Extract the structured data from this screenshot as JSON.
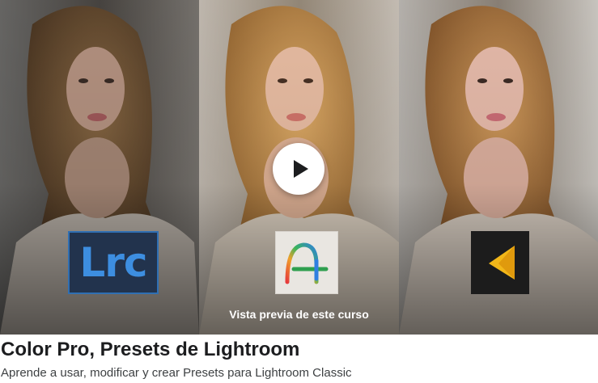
{
  "preview": {
    "label": "Vista previa de este curso",
    "play_icon": "play-icon",
    "panels": [
      {
        "name": "original",
        "tone": "muted"
      },
      {
        "name": "warm",
        "tone": "warm"
      },
      {
        "name": "neutral",
        "tone": "neutral"
      }
    ],
    "logos": {
      "lightroom_classic": "Lrc",
      "adobe_portfolio_icon": "a-plus-logo",
      "v_logo_icon": "yellow-v-logo"
    }
  },
  "course": {
    "title": "Color Pro, Presets de Lightroom",
    "subtitle": "Aprende a usar, modificar y crear Presets para Lightroom Classic"
  },
  "colors": {
    "title": "#1c1d1f",
    "subtitle": "#3e4143",
    "play_button_bg": "#ffffff",
    "lrc_blue": "#3d8ee0"
  }
}
